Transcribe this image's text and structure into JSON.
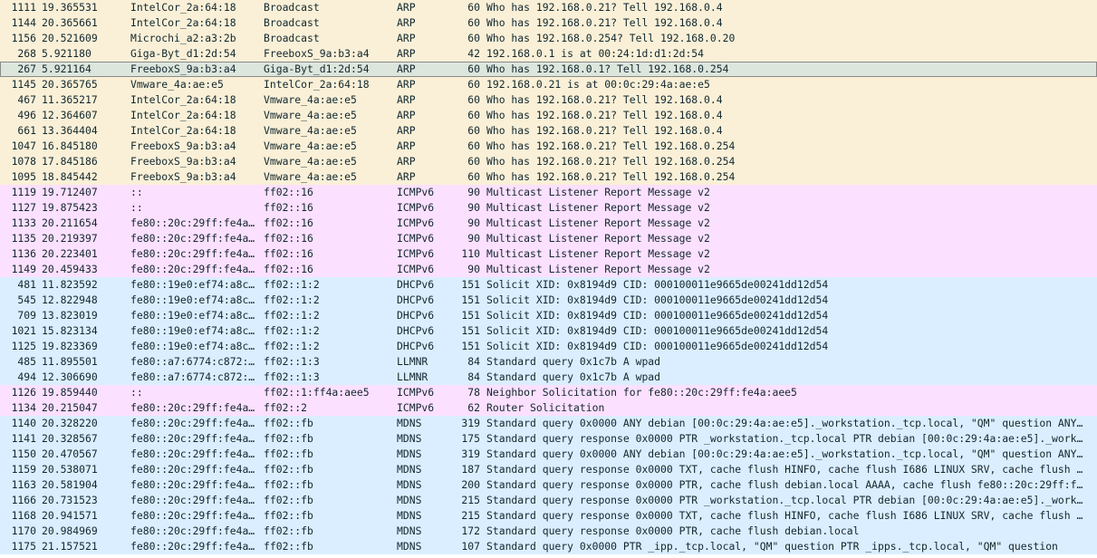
{
  "colors": {
    "ARP": "#faf0d7",
    "ICMPv6": "#fce0ff",
    "UDP": "#daeeff",
    "selected": "#dde6dd"
  },
  "packets": [
    {
      "no": "1111",
      "time": "19.365531",
      "src": "IntelCor_2a:64:18",
      "dst": "Broadcast",
      "proto": "ARP",
      "len": "60",
      "info": "Who has 192.168.0.21? Tell 192.168.0.4",
      "color": "ARP"
    },
    {
      "no": "1144",
      "time": "20.365661",
      "src": "IntelCor_2a:64:18",
      "dst": "Broadcast",
      "proto": "ARP",
      "len": "60",
      "info": "Who has 192.168.0.21? Tell 192.168.0.4",
      "color": "ARP"
    },
    {
      "no": "1156",
      "time": "20.521609",
      "src": "Microchi_a2:a3:2b",
      "dst": "Broadcast",
      "proto": "ARP",
      "len": "60",
      "info": "Who has 192.168.0.254? Tell 192.168.0.20",
      "color": "ARP"
    },
    {
      "no": "268",
      "time": "5.921180",
      "src": "Giga-Byt_d1:2d:54",
      "dst": "FreeboxS_9a:b3:a4",
      "proto": "ARP",
      "len": "42",
      "info": "192.168.0.1 is at 00:24:1d:d1:2d:54",
      "color": "ARP"
    },
    {
      "no": "267",
      "time": "5.921164",
      "src": "FreeboxS_9a:b3:a4",
      "dst": "Giga-Byt_d1:2d:54",
      "proto": "ARP",
      "len": "60",
      "info": "Who has 192.168.0.1? Tell 192.168.0.254",
      "color": "selected",
      "selected": true
    },
    {
      "no": "1145",
      "time": "20.365765",
      "src": "Vmware_4a:ae:e5",
      "dst": "IntelCor_2a:64:18",
      "proto": "ARP",
      "len": "60",
      "info": "192.168.0.21 is at 00:0c:29:4a:ae:e5",
      "color": "ARP"
    },
    {
      "no": "467",
      "time": "11.365217",
      "src": "IntelCor_2a:64:18",
      "dst": "Vmware_4a:ae:e5",
      "proto": "ARP",
      "len": "60",
      "info": "Who has 192.168.0.21? Tell 192.168.0.4",
      "color": "ARP"
    },
    {
      "no": "496",
      "time": "12.364607",
      "src": "IntelCor_2a:64:18",
      "dst": "Vmware_4a:ae:e5",
      "proto": "ARP",
      "len": "60",
      "info": "Who has 192.168.0.21? Tell 192.168.0.4",
      "color": "ARP"
    },
    {
      "no": "661",
      "time": "13.364404",
      "src": "IntelCor_2a:64:18",
      "dst": "Vmware_4a:ae:e5",
      "proto": "ARP",
      "len": "60",
      "info": "Who has 192.168.0.21? Tell 192.168.0.4",
      "color": "ARP"
    },
    {
      "no": "1047",
      "time": "16.845180",
      "src": "FreeboxS_9a:b3:a4",
      "dst": "Vmware_4a:ae:e5",
      "proto": "ARP",
      "len": "60",
      "info": "Who has 192.168.0.21? Tell 192.168.0.254",
      "color": "ARP"
    },
    {
      "no": "1078",
      "time": "17.845186",
      "src": "FreeboxS_9a:b3:a4",
      "dst": "Vmware_4a:ae:e5",
      "proto": "ARP",
      "len": "60",
      "info": "Who has 192.168.0.21? Tell 192.168.0.254",
      "color": "ARP"
    },
    {
      "no": "1095",
      "time": "18.845442",
      "src": "FreeboxS_9a:b3:a4",
      "dst": "Vmware_4a:ae:e5",
      "proto": "ARP",
      "len": "60",
      "info": "Who has 192.168.0.21? Tell 192.168.0.254",
      "color": "ARP"
    },
    {
      "no": "1119",
      "time": "19.712407",
      "src": "::",
      "dst": "ff02::16",
      "proto": "ICMPv6",
      "len": "90",
      "info": "Multicast Listener Report Message v2",
      "color": "ICMPv6"
    },
    {
      "no": "1127",
      "time": "19.875423",
      "src": "::",
      "dst": "ff02::16",
      "proto": "ICMPv6",
      "len": "90",
      "info": "Multicast Listener Report Message v2",
      "color": "ICMPv6"
    },
    {
      "no": "1133",
      "time": "20.211654",
      "src": "fe80::20c:29ff:fe4a…",
      "dst": "ff02::16",
      "proto": "ICMPv6",
      "len": "90",
      "info": "Multicast Listener Report Message v2",
      "color": "ICMPv6"
    },
    {
      "no": "1135",
      "time": "20.219397",
      "src": "fe80::20c:29ff:fe4a…",
      "dst": "ff02::16",
      "proto": "ICMPv6",
      "len": "90",
      "info": "Multicast Listener Report Message v2",
      "color": "ICMPv6"
    },
    {
      "no": "1136",
      "time": "20.223401",
      "src": "fe80::20c:29ff:fe4a…",
      "dst": "ff02::16",
      "proto": "ICMPv6",
      "len": "110",
      "info": "Multicast Listener Report Message v2",
      "color": "ICMPv6"
    },
    {
      "no": "1149",
      "time": "20.459433",
      "src": "fe80::20c:29ff:fe4a…",
      "dst": "ff02::16",
      "proto": "ICMPv6",
      "len": "90",
      "info": "Multicast Listener Report Message v2",
      "color": "ICMPv6"
    },
    {
      "no": "481",
      "time": "11.823592",
      "src": "fe80::19e0:ef74:a8c…",
      "dst": "ff02::1:2",
      "proto": "DHCPv6",
      "len": "151",
      "info": "Solicit XID: 0x8194d9 CID: 000100011e9665de00241dd12d54",
      "color": "UDP"
    },
    {
      "no": "545",
      "time": "12.822948",
      "src": "fe80::19e0:ef74:a8c…",
      "dst": "ff02::1:2",
      "proto": "DHCPv6",
      "len": "151",
      "info": "Solicit XID: 0x8194d9 CID: 000100011e9665de00241dd12d54",
      "color": "UDP"
    },
    {
      "no": "709",
      "time": "13.823019",
      "src": "fe80::19e0:ef74:a8c…",
      "dst": "ff02::1:2",
      "proto": "DHCPv6",
      "len": "151",
      "info": "Solicit XID: 0x8194d9 CID: 000100011e9665de00241dd12d54",
      "color": "UDP"
    },
    {
      "no": "1021",
      "time": "15.823134",
      "src": "fe80::19e0:ef74:a8c…",
      "dst": "ff02::1:2",
      "proto": "DHCPv6",
      "len": "151",
      "info": "Solicit XID: 0x8194d9 CID: 000100011e9665de00241dd12d54",
      "color": "UDP"
    },
    {
      "no": "1125",
      "time": "19.823369",
      "src": "fe80::19e0:ef74:a8c…",
      "dst": "ff02::1:2",
      "proto": "DHCPv6",
      "len": "151",
      "info": "Solicit XID: 0x8194d9 CID: 000100011e9665de00241dd12d54",
      "color": "UDP"
    },
    {
      "no": "485",
      "time": "11.895501",
      "src": "fe80::a7:6774:c872:…",
      "dst": "ff02::1:3",
      "proto": "LLMNR",
      "len": "84",
      "info": "Standard query 0x1c7b A wpad",
      "color": "UDP"
    },
    {
      "no": "494",
      "time": "12.306690",
      "src": "fe80::a7:6774:c872:…",
      "dst": "ff02::1:3",
      "proto": "LLMNR",
      "len": "84",
      "info": "Standard query 0x1c7b A wpad",
      "color": "UDP"
    },
    {
      "no": "1126",
      "time": "19.859440",
      "src": "::",
      "dst": "ff02::1:ff4a:aee5",
      "proto": "ICMPv6",
      "len": "78",
      "info": "Neighbor Solicitation for fe80::20c:29ff:fe4a:aee5",
      "color": "ICMPv6"
    },
    {
      "no": "1134",
      "time": "20.215047",
      "src": "fe80::20c:29ff:fe4a…",
      "dst": "ff02::2",
      "proto": "ICMPv6",
      "len": "62",
      "info": "Router Solicitation",
      "color": "ICMPv6"
    },
    {
      "no": "1140",
      "time": "20.328220",
      "src": "fe80::20c:29ff:fe4a…",
      "dst": "ff02::fb",
      "proto": "MDNS",
      "len": "319",
      "info": "Standard query 0x0000 ANY debian [00:0c:29:4a:ae:e5]._workstation._tcp.local, \"QM\" question ANY…",
      "color": "UDP"
    },
    {
      "no": "1141",
      "time": "20.328567",
      "src": "fe80::20c:29ff:fe4a…",
      "dst": "ff02::fb",
      "proto": "MDNS",
      "len": "175",
      "info": "Standard query response 0x0000 PTR _workstation._tcp.local PTR debian [00:0c:29:4a:ae:e5]._work…",
      "color": "UDP"
    },
    {
      "no": "1150",
      "time": "20.470567",
      "src": "fe80::20c:29ff:fe4a…",
      "dst": "ff02::fb",
      "proto": "MDNS",
      "len": "319",
      "info": "Standard query 0x0000 ANY debian [00:0c:29:4a:ae:e5]._workstation._tcp.local, \"QM\" question ANY…",
      "color": "UDP"
    },
    {
      "no": "1159",
      "time": "20.538071",
      "src": "fe80::20c:29ff:fe4a…",
      "dst": "ff02::fb",
      "proto": "MDNS",
      "len": "187",
      "info": "Standard query response 0x0000 TXT, cache flush HINFO, cache flush I686 LINUX SRV, cache flush …",
      "color": "UDP"
    },
    {
      "no": "1163",
      "time": "20.581904",
      "src": "fe80::20c:29ff:fe4a…",
      "dst": "ff02::fb",
      "proto": "MDNS",
      "len": "200",
      "info": "Standard query response 0x0000 PTR, cache flush debian.local AAAA, cache flush fe80::20c:29ff:f…",
      "color": "UDP"
    },
    {
      "no": "1166",
      "time": "20.731523",
      "src": "fe80::20c:29ff:fe4a…",
      "dst": "ff02::fb",
      "proto": "MDNS",
      "len": "215",
      "info": "Standard query response 0x0000 PTR _workstation._tcp.local PTR debian [00:0c:29:4a:ae:e5]._work…",
      "color": "UDP"
    },
    {
      "no": "1168",
      "time": "20.941571",
      "src": "fe80::20c:29ff:fe4a…",
      "dst": "ff02::fb",
      "proto": "MDNS",
      "len": "215",
      "info": "Standard query response 0x0000 TXT, cache flush HINFO, cache flush I686 LINUX SRV, cache flush …",
      "color": "UDP"
    },
    {
      "no": "1170",
      "time": "20.984969",
      "src": "fe80::20c:29ff:fe4a…",
      "dst": "ff02::fb",
      "proto": "MDNS",
      "len": "172",
      "info": "Standard query response 0x0000 PTR, cache flush debian.local",
      "color": "UDP"
    },
    {
      "no": "1175",
      "time": "21.157521",
      "src": "fe80::20c:29ff:fe4a…",
      "dst": "ff02::fb",
      "proto": "MDNS",
      "len": "107",
      "info": "Standard query 0x0000 PTR _ipp._tcp.local, \"QM\" question PTR _ipps._tcp.local, \"QM\" question",
      "color": "UDP"
    }
  ]
}
